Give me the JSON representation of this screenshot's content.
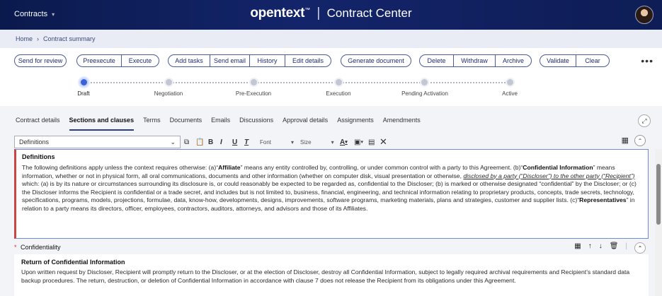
{
  "header": {
    "app_menu": "Contracts",
    "brand_logo": "opentext",
    "brand_tm": "™",
    "separator": "|",
    "product": "Contract Center"
  },
  "breadcrumb": {
    "home": "Home",
    "sep": "›",
    "current": "Contract summary"
  },
  "actions": {
    "send_for_review": "Send for review",
    "preexecute": "Preexecute",
    "execute": "Execute",
    "add_tasks": "Add tasks",
    "send_email": "Send email",
    "history": "History",
    "edit_details": "Edit details",
    "generate_document": "Generate document",
    "delete": "Delete",
    "withdraw": "Withdraw",
    "archive": "Archive",
    "validate": "Validate",
    "clear": "Clear",
    "more": "•••"
  },
  "stepper": {
    "steps": [
      "Draft",
      "Negotiation",
      "Pre-Execution",
      "Execution",
      "Pending Activation",
      "Active"
    ],
    "current_index": 0
  },
  "tabs": [
    "Contract details",
    "Sections and clauses",
    "Terms",
    "Documents",
    "Emails",
    "Discussions",
    "Approval details",
    "Assignments",
    "Amendments"
  ],
  "active_tab": "Sections and clauses",
  "toolbar": {
    "clause_select": "Definitions",
    "bold": "B",
    "italic": "I",
    "underline": "U",
    "clear_format": "T",
    "font": "Font",
    "size": "Size",
    "font_color": "A",
    "close": "✕"
  },
  "editor": {
    "title": "Definitions",
    "p1": "The following definitions apply unless the context requires otherwise: (a)“",
    "affiliate": "Affiliate",
    "p2": "” means any entity controlled by, controlling, or under common control with a party to this Agreement. (b)“",
    "confidential": "Confidential Information",
    "p3": "” means information, whether or not in physical form, all oral communications, documents and other information (whether on computer disk, visual presentation or otherwise, ",
    "disclosed": "disclosed by a party (“Discloser”) to the other party (“Recipient”)",
    "p4": " which: (a) is by its nature or circumstances surrounding its disclosure is, or could reasonably be expected to be regarded as, confidential to the Discloser; (b) is marked or otherwise designated “confidential” by the Discloser; or (c) the Discloser informs the Recipient is confidential or a trade secret, and includes but is not limited to, business, financial, engineering, and technical information relating to proprietary products, concepts, trade secrets, technology, specifications, programs, models, projections, formulae, data, know-how, developments, designs, improvements, software programs, marketing materials, plans and strategies, customer and supplier lists. (c)“",
    "representatives": "Representatives",
    "p5": "” in relation to a party means its directors, officer, employees, contractors, auditors, attorneys, and advisors and those of its Affiliates."
  },
  "section2": {
    "required": "*",
    "title": "Confidentiality",
    "clause_title": "Return of Confidential Information",
    "clause_body": "Upon written request by Discloser, Recipient will promptly return to the Discloser, or at the election of Discloser, destroy all Confidential Information, subject to legally required archival requirements and Recipient’s standard data backup procedures. The return, destruction, or deletion of Confidential Information in accordance with clause 7 does not release the Recipient from its obligations under this Agreement."
  },
  "colors": {
    "header_bg": "#13246a",
    "accent": "#3b63d9",
    "button_border": "#4a5a9a"
  }
}
